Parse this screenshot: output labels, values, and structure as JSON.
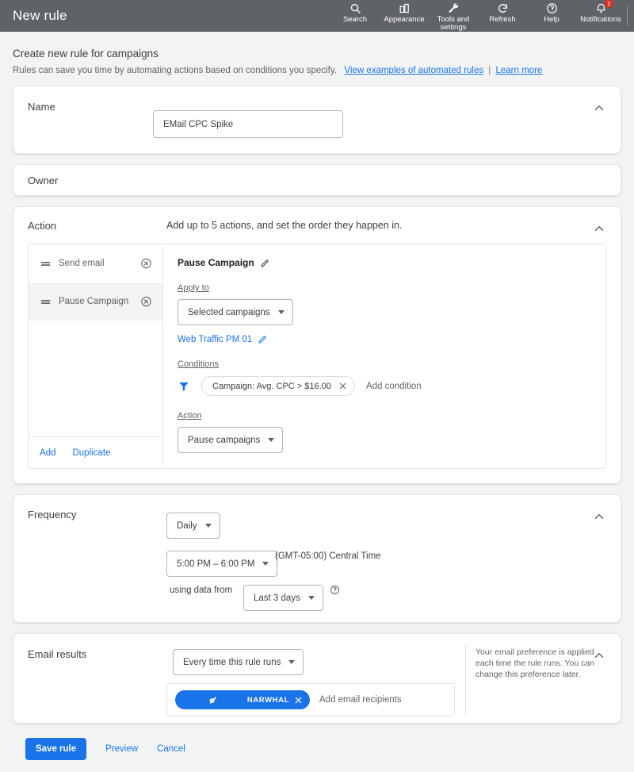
{
  "appbar": {
    "title": "New rule",
    "tools": [
      {
        "label": "Search",
        "icon": "search-icon",
        "badge": null
      },
      {
        "label": "Appearance",
        "icon": "appearance-icon",
        "badge": null
      },
      {
        "label": "Tools and\nsettings",
        "icon": "wrench-icon",
        "badge": null
      },
      {
        "label": "Refresh",
        "icon": "refresh-icon",
        "badge": null
      },
      {
        "label": "Help",
        "icon": "help-icon",
        "badge": null
      },
      {
        "label": "Notifications",
        "icon": "bell-icon",
        "badge": "2"
      }
    ]
  },
  "page": {
    "title": "Create new rule for campaigns",
    "subtitle_text": "Rules can save you time by automating actions based on conditions you specify.",
    "link_examples": "View examples of automated rules",
    "link_separator": "|",
    "link_learn_more": "Learn more"
  },
  "name_card": {
    "label": "Name",
    "value": "EMail CPC Spike",
    "placeholder": "Name"
  },
  "owner_card": {
    "label": "Owner"
  },
  "action_card": {
    "label": "Action",
    "hint": "Add up to 5 actions, and set the order they happen in.",
    "items": [
      {
        "name": "Send email"
      },
      {
        "name": "Pause Campaign"
      }
    ],
    "footer": {
      "add": "Add",
      "duplicate": "Duplicate"
    },
    "detail": {
      "title": "Pause Campaign",
      "apply_to_label": "Apply to",
      "apply_to_value": "Selected campaigns",
      "campaign_link": "Web Traffic PM 01",
      "conditions_label": "Conditions",
      "condition_chip": "Campaign: Avg. CPC > $16.00",
      "add_condition": "Add condition",
      "action_label": "Action",
      "action_value": "Pause campaigns"
    }
  },
  "frequency_card": {
    "label": "Frequency",
    "daily": "Daily",
    "time_range": "5:00 PM – 6:00 PM",
    "timezone": "(GMT-05:00) Central Time",
    "using_data_from": "using data from",
    "data_range": "Last 3 days"
  },
  "email_card": {
    "label": "Email results",
    "frequency_value": "Every time this rule runs",
    "recipient_chip": "NARWHAL",
    "recipients_placeholder": "Add email recipients",
    "note": "Your email preference is applied each time the rule runs. You can change this preference later."
  },
  "footer": {
    "save": "Save rule",
    "preview": "Preview",
    "cancel": "Cancel"
  },
  "colors": {
    "appbar_bg": "#5f6368",
    "accent_blue": "#1a73e8",
    "badge_red": "#d93025",
    "page_bg": "#f1f3f4"
  }
}
